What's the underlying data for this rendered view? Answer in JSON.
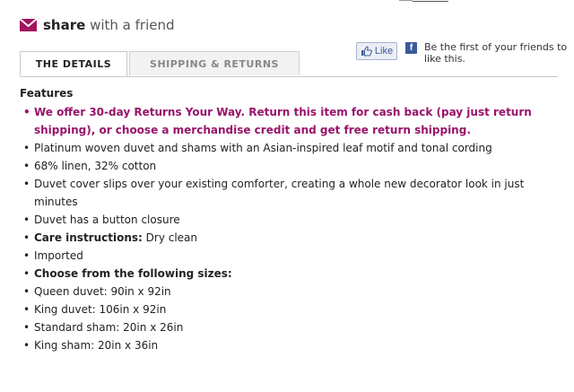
{
  "share": {
    "icon": "envelope-icon",
    "bold": "share",
    "rest": " with a friend",
    "icon_color": "#a3145e"
  },
  "tabs": [
    {
      "label": "THE DETAILS",
      "active": true
    },
    {
      "label": "SHIPPING & RETURNS",
      "active": false
    }
  ],
  "facebook": {
    "like_label": "Like",
    "text": "Be the first of your friends to like this.",
    "brand_color": "#3b5998"
  },
  "features": {
    "heading": "Features",
    "promo": "We offer 30-day Returns Your Way. Return this item for cash back (pay just return shipping), or choose a merchandise credit and get free return shipping.",
    "promo_color": "#98146a",
    "items": [
      "Platinum woven duvet and shams with an Asian-inspired leaf motif and tonal cording",
      "68% linen, 32% cotton",
      "Duvet cover slips over your existing comforter, creating a whole new decorator look in just minutes",
      "Duvet has a button closure"
    ],
    "care_label": "Care instructions:",
    "care_value": " Dry clean",
    "imported": "Imported",
    "sizes_heading": "Choose from the following sizes:",
    "sizes": [
      "Queen duvet: 90in x 92in",
      "King duvet: 106in x 92in",
      "Standard sham: 20in x 26in",
      "King sham: 20in x 36in"
    ]
  }
}
